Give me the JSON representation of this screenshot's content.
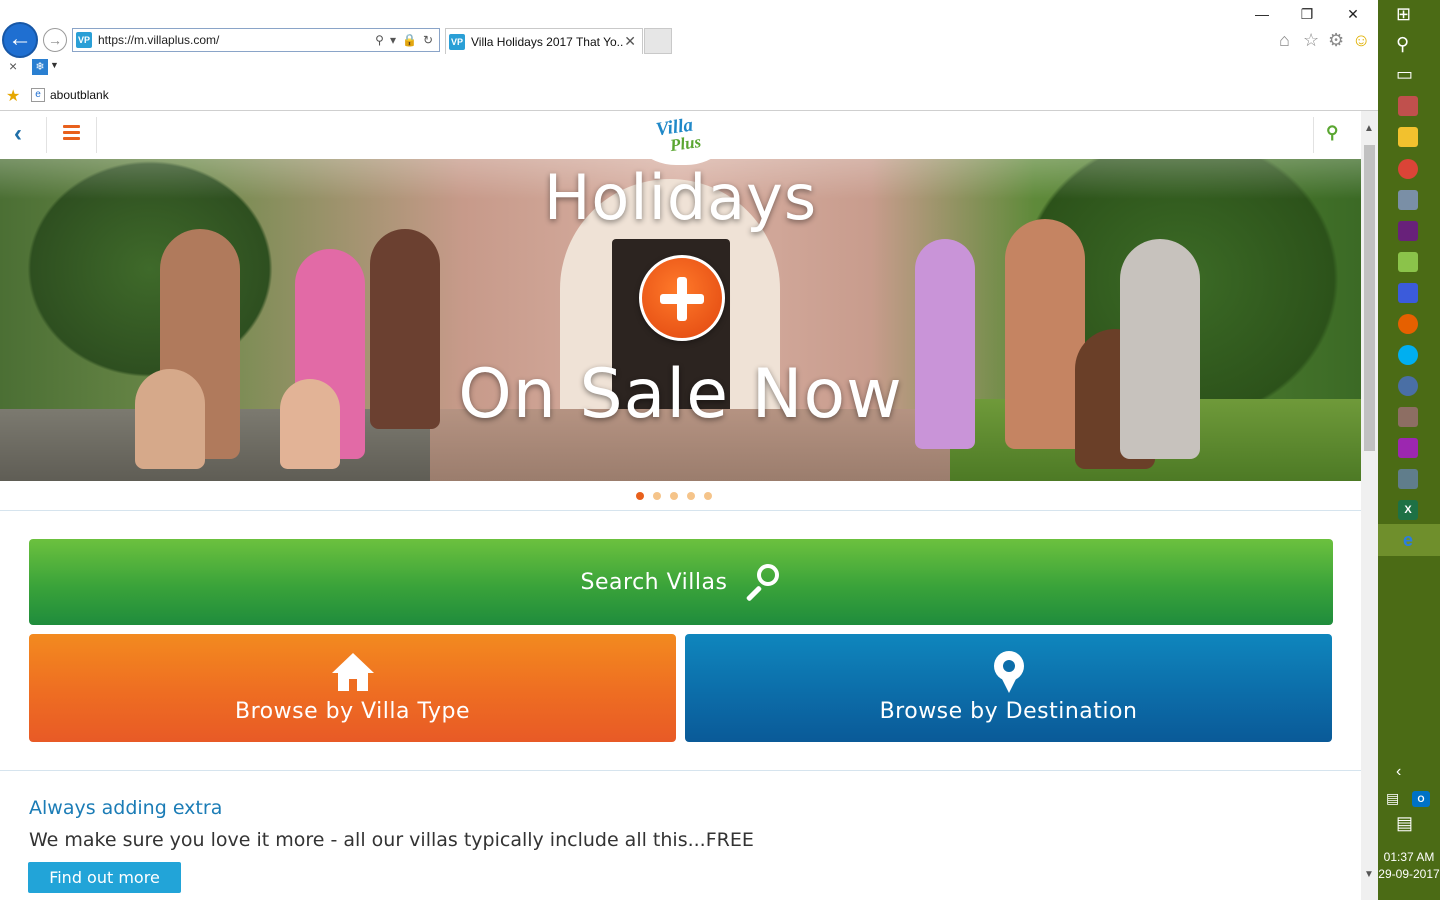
{
  "browser": {
    "url": "https://m.villaplus.com/",
    "tab_title": "Villa Holidays 2017 That Yo...",
    "favorites_item": "aboutblank",
    "favicon_text": "VP"
  },
  "site": {
    "logo": {
      "line1": "Villa",
      "line2": "Plus"
    },
    "hero": {
      "line1": "Holidays",
      "line2": "On Sale Now",
      "slide_count": 5,
      "active_slide": 1
    },
    "actions": {
      "search_villas": "Search Villas",
      "browse_villa_type": "Browse by Villa Type",
      "browse_destination": "Browse by Destination"
    },
    "extra": {
      "title": "Always adding extra",
      "text": "We make sure you love it more - all our villas typically include all this...FREE",
      "button": "Find out more"
    }
  },
  "taskbar": {
    "time": "01:37 AM",
    "date": "29-09-2017"
  },
  "colors": {
    "brand_orange": "#e8601c",
    "brand_blue": "#1b7cb6",
    "brand_green": "#3aa33a",
    "taskbar_green": "#4b6b15"
  }
}
